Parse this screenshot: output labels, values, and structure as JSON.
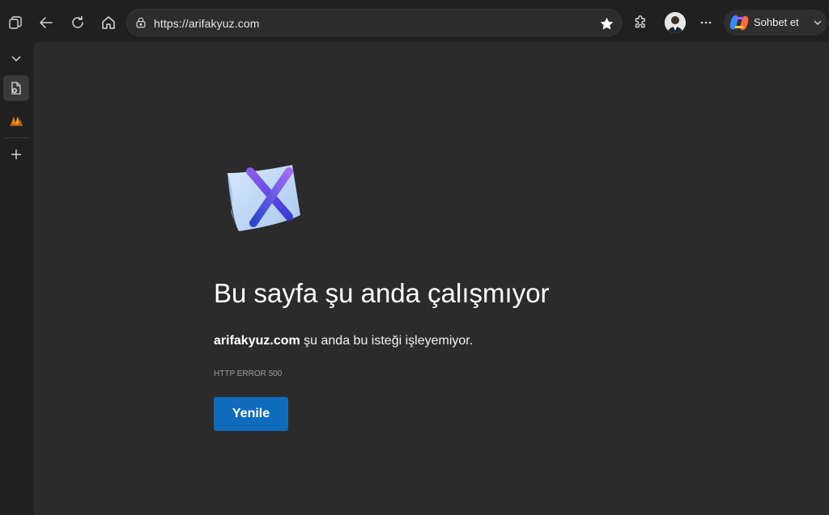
{
  "toolbar": {
    "url": "https://arifakyuz.com",
    "copilot_label": "Sohbet et",
    "icons": [
      "workspaces-icon",
      "back-icon",
      "refresh-icon",
      "home-icon",
      "lock-icon",
      "favorite-star-icon",
      "extensions-icon",
      "profile-avatar",
      "more-menu-icon",
      "copilot-icon",
      "chevron-down-icon"
    ]
  },
  "sidebar": {
    "icons": [
      "collapse-chevron-icon",
      "error-page-tab-icon",
      "site-tab-icon",
      "new-tab-icon"
    ]
  },
  "error_page": {
    "title": "Bu sayfa şu anda çalışmıyor",
    "domain": "arifakyuz.com",
    "message_rest": " şu anda bu isteği işleyemiyor.",
    "code": "HTTP ERROR 500",
    "reload_label": "Yenile"
  },
  "colors": {
    "background": "#202020",
    "content_background": "#2b2b2b",
    "accent_button": "#0f6cbd",
    "text": "#ffffff",
    "muted_text": "#9e9e9e"
  }
}
